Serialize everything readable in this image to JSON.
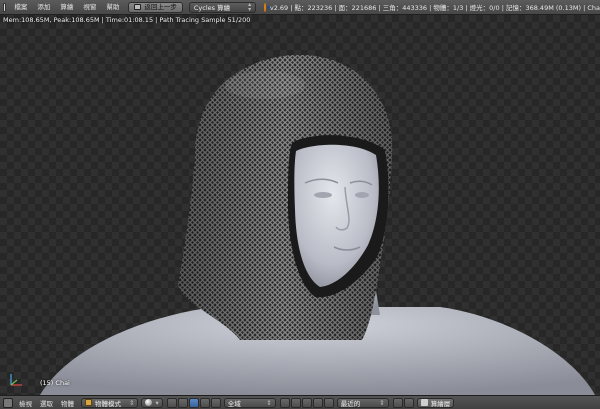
{
  "topbar": {
    "menus": [
      "檔案",
      "添加",
      "算繪",
      "視窗",
      "幫助"
    ],
    "back_button": "返回上一步",
    "engine": "Cycles 算繪",
    "stats": "v2.69 | 點：223236 | 面：221686 | 三角：443336 | 物體：1/3 | 燈光：0/0 | 記憶：368.49M (0.13M) | Cha"
  },
  "viewport": {
    "render_info": "Mem:108.65M, Peak:108.65M | Time:01:08.15 | Path Tracing Sample 51/200",
    "object_label": "(15) Chai"
  },
  "bottombar": {
    "menus": [
      "檢視",
      "選取",
      "物體"
    ],
    "mode": "物體模式",
    "pivot": "全域",
    "snap": "最近的",
    "render_layers": "算繪層"
  },
  "icons": {
    "app": "editor-type-icon",
    "blender": "blender-logo-icon",
    "axes": "axes-gizmo-icon"
  },
  "colors": {
    "accent": "#e87d0d",
    "active_tool": "#4a77b5",
    "chainmail": "#9a9a9a",
    "skin": "#c8cbd3"
  }
}
